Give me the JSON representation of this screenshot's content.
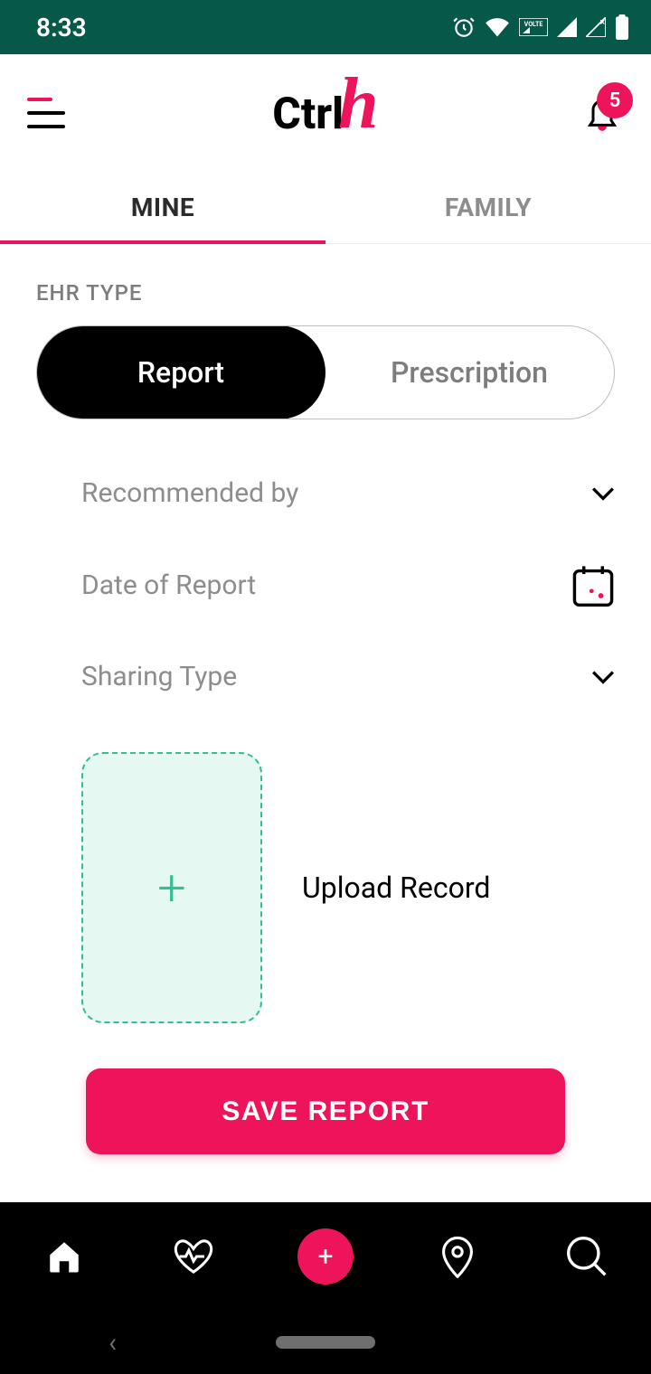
{
  "status": {
    "time": "8:33"
  },
  "header": {
    "logo_text": "Ctrl",
    "logo_script": "h",
    "notif_count": "5"
  },
  "tabs": {
    "mine": "MINE",
    "family": "FAMILY"
  },
  "form": {
    "section_label": "EHR TYPE",
    "seg_report": "Report",
    "seg_prescription": "Prescription",
    "recommended_by": "Recommended by",
    "date_of_report": "Date of Report",
    "sharing_type": "Sharing Type",
    "upload_label": "Upload Record",
    "save_button": "SAVE REPORT"
  }
}
